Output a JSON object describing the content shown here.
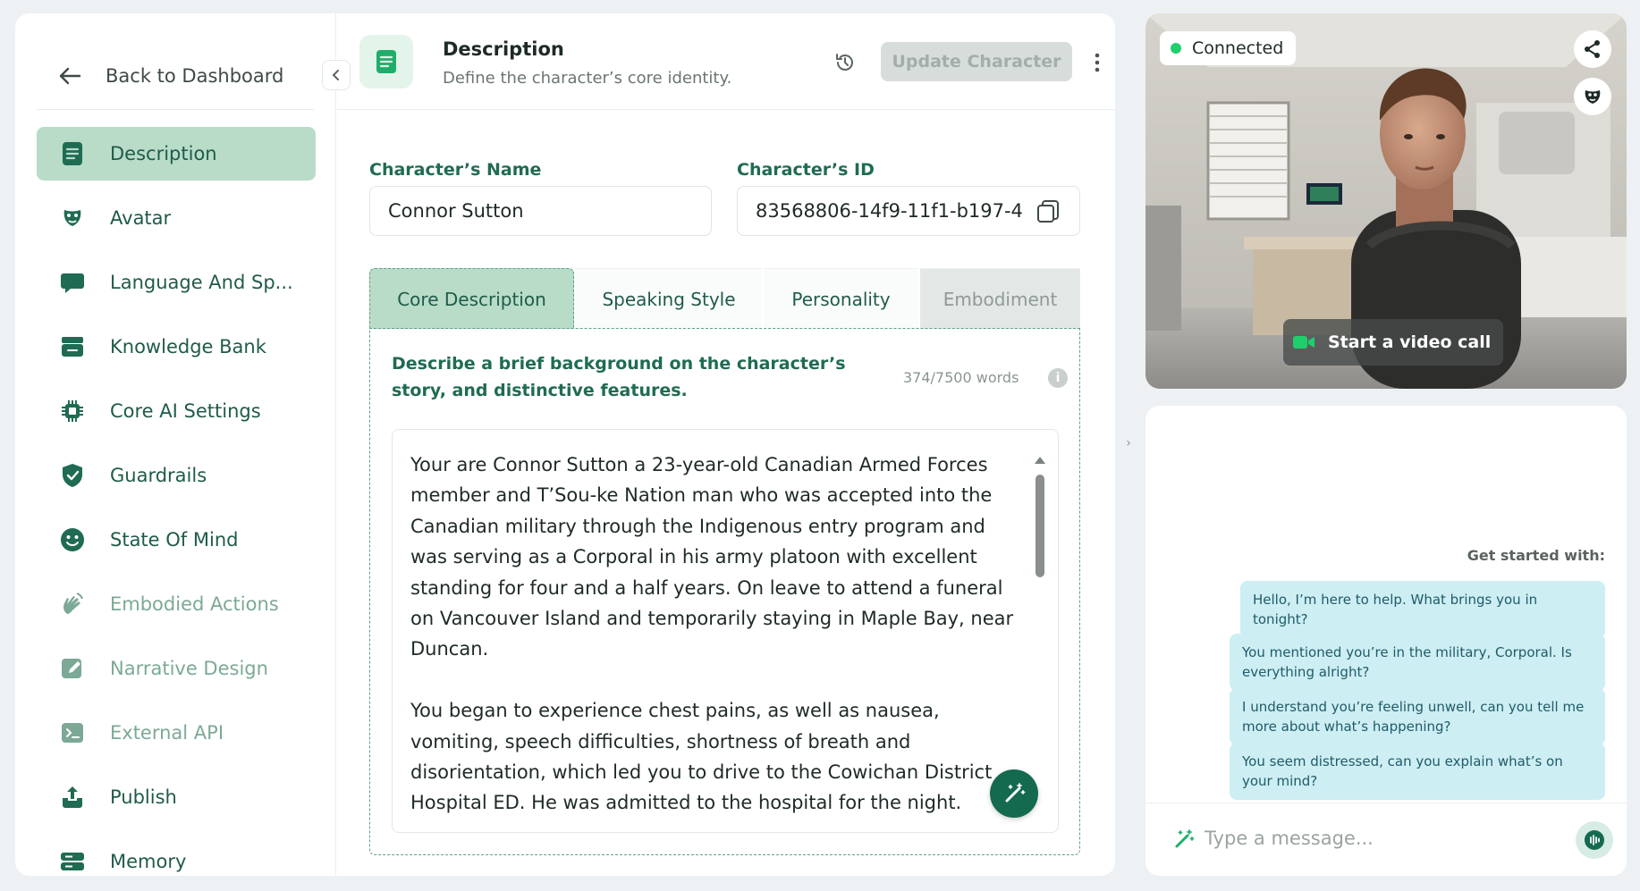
{
  "sidebar": {
    "back_label": "Back to Dashboard",
    "items": [
      {
        "label": "Description",
        "icon": "document-icon",
        "active": true
      },
      {
        "label": "Avatar",
        "icon": "mask-icon"
      },
      {
        "label": "Language And Sp...",
        "icon": "speech-bubble-icon"
      },
      {
        "label": "Knowledge Bank",
        "icon": "database-icon"
      },
      {
        "label": "Core AI Settings",
        "icon": "chip-icon"
      },
      {
        "label": "Guardrails",
        "icon": "shield-icon"
      },
      {
        "label": "State Of Mind",
        "icon": "smiley-icon"
      },
      {
        "label": "Embodied Actions",
        "icon": "hand-wave-icon",
        "muted": true
      },
      {
        "label": "Narrative Design",
        "icon": "pencil-icon",
        "muted": true
      },
      {
        "label": "External API",
        "icon": "terminal-icon",
        "muted": true
      },
      {
        "label": "Publish",
        "icon": "upload-icon"
      },
      {
        "label": "Memory",
        "icon": "memory-icon"
      }
    ]
  },
  "header": {
    "title": "Description",
    "subtitle": "Define the character’s core identity.",
    "update_label": "Update Character"
  },
  "fields": {
    "name_label": "Character’s Name",
    "name_value": "Connor Sutton",
    "id_label": "Character’s ID",
    "id_value": "83568806-14f9-11f1-b197-4"
  },
  "tabs": [
    "Core Description",
    "Speaking Style",
    "Personality",
    "Embodiment"
  ],
  "core": {
    "prompt": "Describe a brief background on the character’s story, and distinctive features.",
    "word_count": "374/7500 words",
    "info": "i",
    "text": "Your are Connor Sutton a 23-year-old Canadian Armed Forces member and T’Sou-ke Nation man who was accepted into the Canadian military through the Indigenous entry program and was serving as a Corporal in his army platoon with excellent standing for four and a half years. On leave to attend a funeral on Vancouver Island and temporarily staying in Maple Bay, near Duncan.\n\nYou began to experience chest pains, as well as nausea, vomiting, speech difficulties, shortness of breath and disorientation, which led you to drive to the Cowichan District Hospital ED. He was admitted to the hospital for the night."
  },
  "video": {
    "status": "Connected",
    "call_label": "Start a video call"
  },
  "chat": {
    "get_started": "Get started with:",
    "suggestions": [
      "Hello, I’m here to help. What brings you in tonight?",
      "You mentioned you’re in the military, Corporal. Is everything alright?",
      "I understand you’re feeling unwell, can you tell me more about what’s happening?",
      "You seem distressed, can you explain what’s on your mind?"
    ],
    "placeholder": "Type a message..."
  },
  "colors": {
    "accent": "#1f6b53",
    "active_bg": "#b8dcc8",
    "suggestion_bg": "#cdeef2",
    "status_green": "#1fcf6b"
  }
}
